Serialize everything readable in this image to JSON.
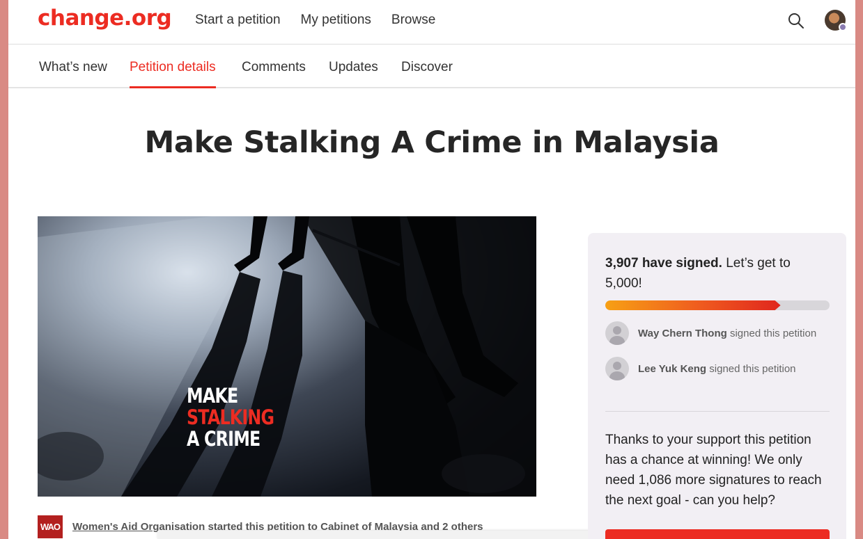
{
  "brand": {
    "logo": "change.org",
    "accent": "#ec2c22"
  },
  "nav": {
    "links": [
      "Start a petition",
      "My petitions",
      "Browse"
    ],
    "search_icon": "search-icon",
    "avatar": "user-avatar"
  },
  "tabs": {
    "items": [
      "What’s new",
      "Petition details",
      "Comments",
      "Updates",
      "Discover"
    ],
    "active": "Petition details"
  },
  "petition": {
    "title": "Make Stalking A Crime in Malaysia",
    "image_text": [
      "MAKE",
      "STALKING",
      "A CRIME"
    ],
    "starter": {
      "org_badge": "WAO",
      "org": "Women's Aid Organisation",
      "started_text": "started this petition to",
      "target": "Cabinet of Malaysia",
      "and": "and",
      "others": "2 others"
    }
  },
  "sidebar": {
    "signed_count": "3,907 have signed.",
    "goal_text": "Let’s get to 5,000!",
    "progress_fraction": 0.7814,
    "signers": [
      {
        "name": "Way Chern Thong",
        "action": "signed this petition"
      },
      {
        "name": "Lee Yuk Keng",
        "action": "signed this petition"
      }
    ],
    "support_text": "Thanks to your support this petition has a chance at winning! We only need 1,086 more signatures to reach the next goal - can you help?"
  }
}
